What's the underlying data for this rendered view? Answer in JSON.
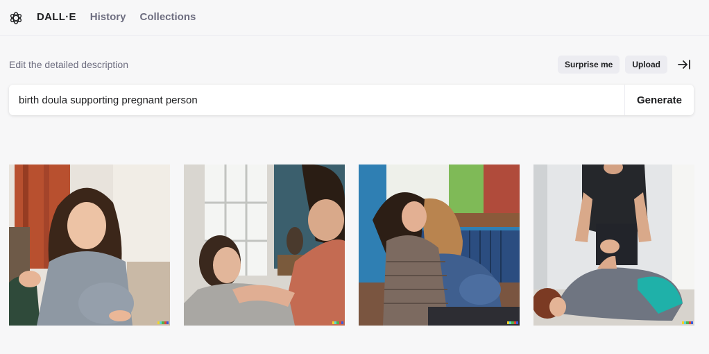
{
  "nav": {
    "logo": "openai-logo-icon",
    "brand": "DALL·E",
    "links": [
      "History",
      "Collections"
    ]
  },
  "prompt": {
    "label": "Edit the detailed description",
    "value": "birth doula supporting pregnant person",
    "generate_label": "Generate"
  },
  "actions": {
    "surprise_label": "Surprise me",
    "upload_label": "Upload",
    "collapse_icon": "arrow-right-to-bar-icon"
  },
  "images": [
    {
      "name": "generated-image-1",
      "subject": "doula comforting smiling pregnant woman by window"
    },
    {
      "name": "generated-image-2",
      "subject": "doula massaging reclining pregnant woman"
    },
    {
      "name": "generated-image-3",
      "subject": "two women seated by radiator, pregnant belly"
    },
    {
      "name": "generated-image-4",
      "subject": "doula standing over pregnant woman lying on floor"
    }
  ],
  "signature_colors": [
    "#f5d327",
    "#5cd3d6",
    "#57b046",
    "#e2463a",
    "#3b5bdb"
  ]
}
